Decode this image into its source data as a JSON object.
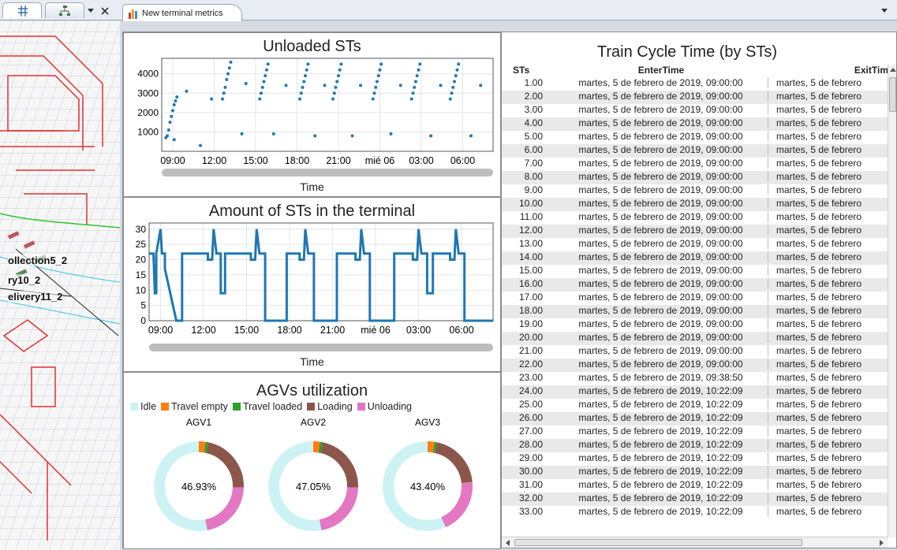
{
  "tabs": {
    "main_title": "New terminal metrics"
  },
  "left_labels": [
    "ollection5_2",
    "ry10_2",
    "elivery11_2"
  ],
  "colors": {
    "line": "#1f77b4",
    "idle": "#ccf2f4",
    "travel_empty": "#ff7f0e",
    "travel_loaded": "#2ca02c",
    "loading": "#8c564b",
    "unloading": "#e377c2",
    "grid": "#e5e5e5"
  },
  "charts": {
    "unloaded": {
      "title": "Unloaded STs",
      "xlabel": "Time"
    },
    "amount": {
      "title": "Amount of STs in the terminal",
      "xlabel": "Time"
    },
    "agv": {
      "title": "AGVs utilization"
    }
  },
  "chart_data": [
    {
      "type": "scatter",
      "title": "Unloaded STs",
      "xlabel": "Time",
      "ylabel": "",
      "ylim": [
        0,
        4800
      ],
      "yticks": [
        1000,
        2000,
        3000,
        4000
      ],
      "xticks": [
        "09:00",
        "12:00",
        "15:00",
        "18:00",
        "21:00",
        "mié 06",
        "03:00",
        "06:00"
      ],
      "x_hours": [
        0,
        3,
        6,
        9,
        12,
        15,
        18,
        21
      ],
      "x_range_hours": [
        -0.8,
        23.2
      ],
      "points": [
        [
          -0.5,
          700
        ],
        [
          -0.4,
          800
        ],
        [
          -0.3,
          1100
        ],
        [
          -0.2,
          1500
        ],
        [
          -0.1,
          1800
        ],
        [
          0,
          2100
        ],
        [
          0.1,
          2400
        ],
        [
          0.2,
          2600
        ],
        [
          0.3,
          2800
        ],
        [
          0.1,
          600
        ],
        [
          1,
          3100
        ],
        [
          2,
          300
        ],
        [
          2.8,
          2700
        ],
        [
          3.6,
          2700
        ],
        [
          3.7,
          3000
        ],
        [
          3.8,
          3300
        ],
        [
          3.9,
          3700
        ],
        [
          4.0,
          4000
        ],
        [
          4.1,
          4300
        ],
        [
          4.2,
          4600
        ],
        [
          5,
          900
        ],
        [
          5.3,
          3500
        ],
        [
          6.3,
          2700
        ],
        [
          6.4,
          3000
        ],
        [
          6.5,
          3300
        ],
        [
          6.6,
          3600
        ],
        [
          6.7,
          3900
        ],
        [
          6.8,
          4200
        ],
        [
          6.9,
          4500
        ],
        [
          7.3,
          900
        ],
        [
          8.2,
          3400
        ],
        [
          9.2,
          2700
        ],
        [
          9.3,
          3000
        ],
        [
          9.4,
          3300
        ],
        [
          9.5,
          3600
        ],
        [
          9.6,
          3900
        ],
        [
          9.7,
          4200
        ],
        [
          9.8,
          4500
        ],
        [
          10.3,
          800
        ],
        [
          11.0,
          3400
        ],
        [
          11.6,
          2700
        ],
        [
          11.7,
          3000
        ],
        [
          11.8,
          3300
        ],
        [
          11.9,
          3600
        ],
        [
          12.0,
          3900
        ],
        [
          12.1,
          4200
        ],
        [
          12.2,
          4500
        ],
        [
          13,
          800
        ],
        [
          13.6,
          3400
        ],
        [
          14.5,
          2700
        ],
        [
          14.6,
          3000
        ],
        [
          14.7,
          3300
        ],
        [
          14.8,
          3600
        ],
        [
          14.9,
          3900
        ],
        [
          15.0,
          4200
        ],
        [
          15.1,
          4500
        ],
        [
          15.8,
          900
        ],
        [
          16.5,
          3400
        ],
        [
          17.3,
          2700
        ],
        [
          17.4,
          3000
        ],
        [
          17.5,
          3300
        ],
        [
          17.6,
          3600
        ],
        [
          17.7,
          3900
        ],
        [
          17.8,
          4200
        ],
        [
          17.9,
          4500
        ],
        [
          18.7,
          800
        ],
        [
          19.4,
          3400
        ],
        [
          20.1,
          2700
        ],
        [
          20.2,
          3000
        ],
        [
          20.3,
          3300
        ],
        [
          20.4,
          3600
        ],
        [
          20.5,
          3900
        ],
        [
          20.6,
          4200
        ],
        [
          20.7,
          4500
        ],
        [
          21.6,
          800
        ],
        [
          22.3,
          3400
        ]
      ]
    },
    {
      "type": "line",
      "title": "Amount of STs in the terminal",
      "xlabel": "Time",
      "ylabel": "",
      "ylim": [
        0,
        32
      ],
      "yticks": [
        0,
        5,
        10,
        15,
        20,
        25,
        30
      ],
      "xticks": [
        "09:00",
        "12:00",
        "15:00",
        "18:00",
        "21:00",
        "mié 06",
        "03:00",
        "06:00"
      ],
      "x_hours": [
        0,
        3,
        6,
        9,
        12,
        15,
        18,
        21
      ],
      "x_range_hours": [
        -0.8,
        23.2
      ],
      "series": [
        {
          "values": [
            [
              -0.8,
              22
            ],
            [
              -0.5,
              22
            ],
            [
              -0.4,
              9
            ],
            [
              -0.3,
              9
            ],
            [
              -0.3,
              22
            ],
            [
              0,
              30
            ],
            [
              0.1,
              22
            ],
            [
              0.3,
              22
            ],
            [
              0.3,
              17
            ],
            [
              1.1,
              0
            ],
            [
              1.5,
              0
            ],
            [
              1.5,
              22
            ],
            [
              3.3,
              22
            ],
            [
              3.3,
              20
            ],
            [
              3.6,
              20
            ],
            [
              3.7,
              30
            ],
            [
              3.9,
              22
            ],
            [
              4.2,
              22
            ],
            [
              4.2,
              9
            ],
            [
              4.5,
              9
            ],
            [
              4.5,
              22
            ],
            [
              6.3,
              22
            ],
            [
              6.3,
              20
            ],
            [
              6.6,
              20
            ],
            [
              6.7,
              30
            ],
            [
              6.9,
              22
            ],
            [
              7.3,
              22
            ],
            [
              7.3,
              0
            ],
            [
              8.8,
              0
            ],
            [
              8.8,
              22
            ],
            [
              9.7,
              22
            ],
            [
              9.7,
              20
            ],
            [
              10,
              20
            ],
            [
              10.1,
              30
            ],
            [
              10.3,
              22
            ],
            [
              10.7,
              22
            ],
            [
              10.7,
              0
            ],
            [
              12.3,
              0
            ],
            [
              12.3,
              22
            ],
            [
              13.6,
              22
            ],
            [
              13.6,
              20
            ],
            [
              13.9,
              20
            ],
            [
              14,
              30
            ],
            [
              14.2,
              22
            ],
            [
              14.6,
              22
            ],
            [
              14.6,
              0
            ],
            [
              16.3,
              0
            ],
            [
              16.3,
              22
            ],
            [
              17.6,
              22
            ],
            [
              17.6,
              20
            ],
            [
              17.9,
              20
            ],
            [
              18,
              30
            ],
            [
              18.2,
              22
            ],
            [
              18.6,
              22
            ],
            [
              18.6,
              9
            ],
            [
              19,
              9
            ],
            [
              19,
              22
            ],
            [
              20.2,
              22
            ],
            [
              20.2,
              20
            ],
            [
              20.5,
              20
            ],
            [
              20.6,
              30
            ],
            [
              20.8,
              22
            ],
            [
              21.2,
              22
            ],
            [
              21.2,
              0
            ],
            [
              23.2,
              0
            ]
          ]
        }
      ]
    },
    {
      "type": "pie",
      "title": "AGVs utilization",
      "legend": [
        "Idle",
        "Travel empty",
        "Travel loaded",
        "Loading",
        "Unloading"
      ],
      "charts": [
        {
          "name": "AGV1",
          "center_label": "46.93%",
          "values": [
            53.07,
            2.5,
            1.0,
            22.0,
            21.43
          ]
        },
        {
          "name": "AGV2",
          "center_label": "47.05%",
          "values": [
            52.95,
            2.5,
            1.0,
            22.0,
            21.55
          ]
        },
        {
          "name": "AGV3",
          "center_label": "43.40%",
          "values": [
            56.6,
            2.5,
            1.0,
            20.0,
            19.9
          ]
        }
      ]
    }
  ],
  "table": {
    "title": "Train Cycle Time (by STs)",
    "headers": [
      "STs",
      "EnterTime",
      "ExitTim"
    ],
    "rows": [
      [
        "1.00",
        "martes, 5 de febrero de 2019, 09:00:00",
        "martes, 5 de febrero"
      ],
      [
        "2.00",
        "martes, 5 de febrero de 2019, 09:00:00",
        "martes, 5 de febrero"
      ],
      [
        "3.00",
        "martes, 5 de febrero de 2019, 09:00:00",
        "martes, 5 de febrero"
      ],
      [
        "4.00",
        "martes, 5 de febrero de 2019, 09:00:00",
        "martes, 5 de febrero"
      ],
      [
        "5.00",
        "martes, 5 de febrero de 2019, 09:00:00",
        "martes, 5 de febrero"
      ],
      [
        "6.00",
        "martes, 5 de febrero de 2019, 09:00:00",
        "martes, 5 de febrero"
      ],
      [
        "7.00",
        "martes, 5 de febrero de 2019, 09:00:00",
        "martes, 5 de febrero"
      ],
      [
        "8.00",
        "martes, 5 de febrero de 2019, 09:00:00",
        "martes, 5 de febrero"
      ],
      [
        "9.00",
        "martes, 5 de febrero de 2019, 09:00:00",
        "martes, 5 de febrero"
      ],
      [
        "10.00",
        "martes, 5 de febrero de 2019, 09:00:00",
        "martes, 5 de febrero"
      ],
      [
        "11.00",
        "martes, 5 de febrero de 2019, 09:00:00",
        "martes, 5 de febrero"
      ],
      [
        "12.00",
        "martes, 5 de febrero de 2019, 09:00:00",
        "martes, 5 de febrero"
      ],
      [
        "13.00",
        "martes, 5 de febrero de 2019, 09:00:00",
        "martes, 5 de febrero"
      ],
      [
        "14.00",
        "martes, 5 de febrero de 2019, 09:00:00",
        "martes, 5 de febrero"
      ],
      [
        "15.00",
        "martes, 5 de febrero de 2019, 09:00:00",
        "martes, 5 de febrero"
      ],
      [
        "16.00",
        "martes, 5 de febrero de 2019, 09:00:00",
        "martes, 5 de febrero"
      ],
      [
        "17.00",
        "martes, 5 de febrero de 2019, 09:00:00",
        "martes, 5 de febrero"
      ],
      [
        "18.00",
        "martes, 5 de febrero de 2019, 09:00:00",
        "martes, 5 de febrero"
      ],
      [
        "19.00",
        "martes, 5 de febrero de 2019, 09:00:00",
        "martes, 5 de febrero"
      ],
      [
        "20.00",
        "martes, 5 de febrero de 2019, 09:00:00",
        "martes, 5 de febrero"
      ],
      [
        "21.00",
        "martes, 5 de febrero de 2019, 09:00:00",
        "martes, 5 de febrero"
      ],
      [
        "22.00",
        "martes, 5 de febrero de 2019, 09:00:00",
        "martes, 5 de febrero"
      ],
      [
        "23.00",
        "martes, 5 de febrero de 2019, 09:38:50",
        "martes, 5 de febrero"
      ],
      [
        "24.00",
        "martes, 5 de febrero de 2019, 10:22:09",
        "martes, 5 de febrero"
      ],
      [
        "25.00",
        "martes, 5 de febrero de 2019, 10:22:09",
        "martes, 5 de febrero"
      ],
      [
        "26.00",
        "martes, 5 de febrero de 2019, 10:22:09",
        "martes, 5 de febrero"
      ],
      [
        "27.00",
        "martes, 5 de febrero de 2019, 10:22:09",
        "martes, 5 de febrero"
      ],
      [
        "28.00",
        "martes, 5 de febrero de 2019, 10:22:09",
        "martes, 5 de febrero"
      ],
      [
        "29.00",
        "martes, 5 de febrero de 2019, 10:22:09",
        "martes, 5 de febrero"
      ],
      [
        "30.00",
        "martes, 5 de febrero de 2019, 10:22:09",
        "martes, 5 de febrero"
      ],
      [
        "31.00",
        "martes, 5 de febrero de 2019, 10:22:09",
        "martes, 5 de febrero"
      ],
      [
        "32.00",
        "martes, 5 de febrero de 2019, 10:22:09",
        "martes, 5 de febrero"
      ],
      [
        "33.00",
        "martes, 5 de febrero de 2019, 10:22:09",
        "martes, 5 de febrero"
      ]
    ]
  }
}
